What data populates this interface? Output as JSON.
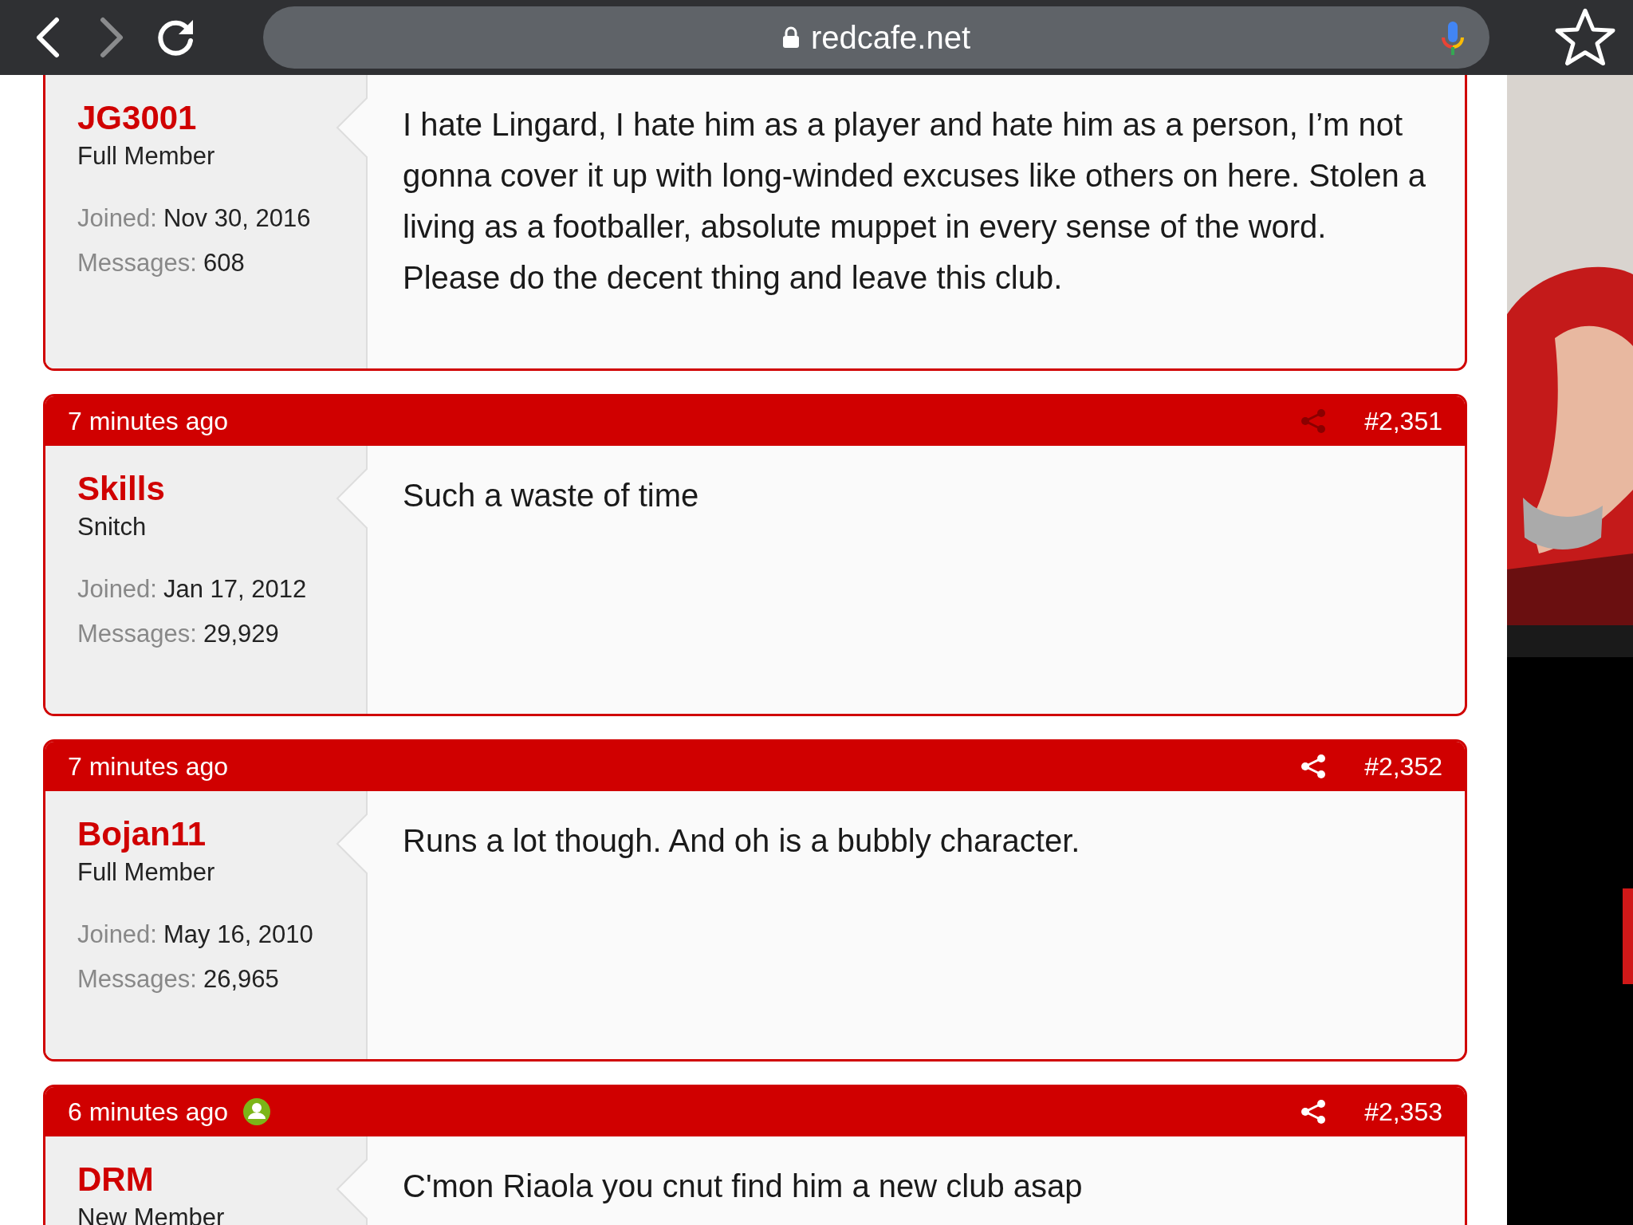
{
  "browser": {
    "url": "redcafe.net"
  },
  "posts": [
    {
      "username": "JG3001",
      "rank": "Full Member",
      "joined_label": "Joined:",
      "joined": "Nov 30, 2016",
      "messages_label": "Messages:",
      "messages": "608",
      "body": "I hate Lingard, I hate him as a player and hate him as a person, I’m not gonna cover it up with long-winded excuses like others on here. Stolen a living as a footballer, absolute muppet in every sense of the word. Please do the decent thing and leave this club."
    },
    {
      "header": {
        "time": "7 minutes ago",
        "online": false,
        "share_dimmed": true,
        "number": "#2,351"
      },
      "username": "Skills",
      "rank": "Snitch",
      "joined_label": "Joined:",
      "joined": "Jan 17, 2012",
      "messages_label": "Messages:",
      "messages": "29,929",
      "body": "Such a waste of time"
    },
    {
      "header": {
        "time": "7 minutes ago",
        "online": false,
        "share_dimmed": false,
        "number": "#2,352"
      },
      "username": "Bojan11",
      "rank": "Full Member",
      "joined_label": "Joined:",
      "joined": "May 16, 2010",
      "messages_label": "Messages:",
      "messages": "26,965",
      "body": "Runs a lot though. And oh is a bubbly character."
    },
    {
      "header": {
        "time": "6 minutes ago",
        "online": true,
        "share_dimmed": false,
        "number": "#2,353"
      },
      "username": "DRM",
      "rank": "New Member",
      "body": "C'mon Riaola you cnut find him a new club asap"
    }
  ]
}
